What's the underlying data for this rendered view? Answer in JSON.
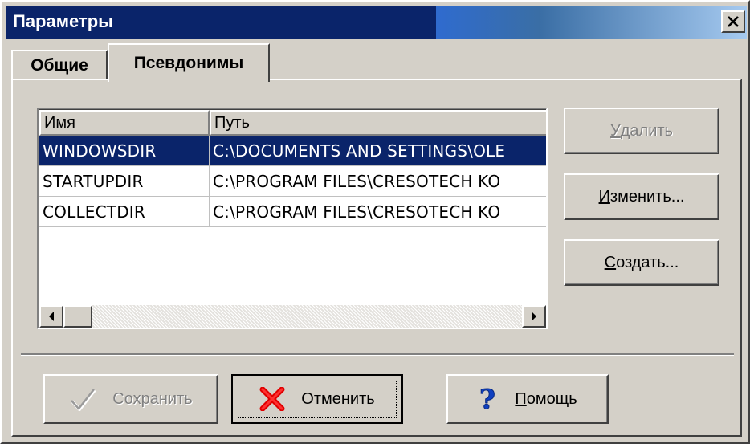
{
  "window": {
    "title": "Параметры",
    "accent_color": "#0a246a"
  },
  "tabs": [
    {
      "label": "Общие",
      "active": false
    },
    {
      "label": "Псевдонимы",
      "active": true
    }
  ],
  "aliases_list": {
    "columns": [
      "Имя",
      "Путь"
    ],
    "rows": [
      {
        "name": "WINDOWSDIR",
        "path": "C:\\DOCUMENTS AND SETTINGS\\OLE",
        "selected": true
      },
      {
        "name": "STARTUPDIR",
        "path": "C:\\PROGRAM FILES\\CRESOTECH KO",
        "selected": false
      },
      {
        "name": "COLLECTDIR",
        "path": "C:\\PROGRAM FILES\\CRESOTECH KO",
        "selected": false
      }
    ]
  },
  "side_buttons": {
    "delete": {
      "label_mnemonic": "У",
      "label_rest": "далить",
      "enabled": false
    },
    "edit": {
      "label_mnemonic": "И",
      "label_rest": "зменить...",
      "enabled": true
    },
    "create": {
      "label_mnemonic": "С",
      "label_rest": "оздать...",
      "enabled": true
    }
  },
  "bottom_buttons": {
    "save": {
      "label": "Сохранить",
      "enabled": false,
      "icon": "checkmark-icon"
    },
    "cancel": {
      "label": "Отменить",
      "enabled": true,
      "icon": "red-x-icon",
      "default": true
    },
    "help": {
      "label_mnemonic": "П",
      "label_rest": "омощь",
      "enabled": true,
      "icon": "question-mark-icon"
    }
  }
}
